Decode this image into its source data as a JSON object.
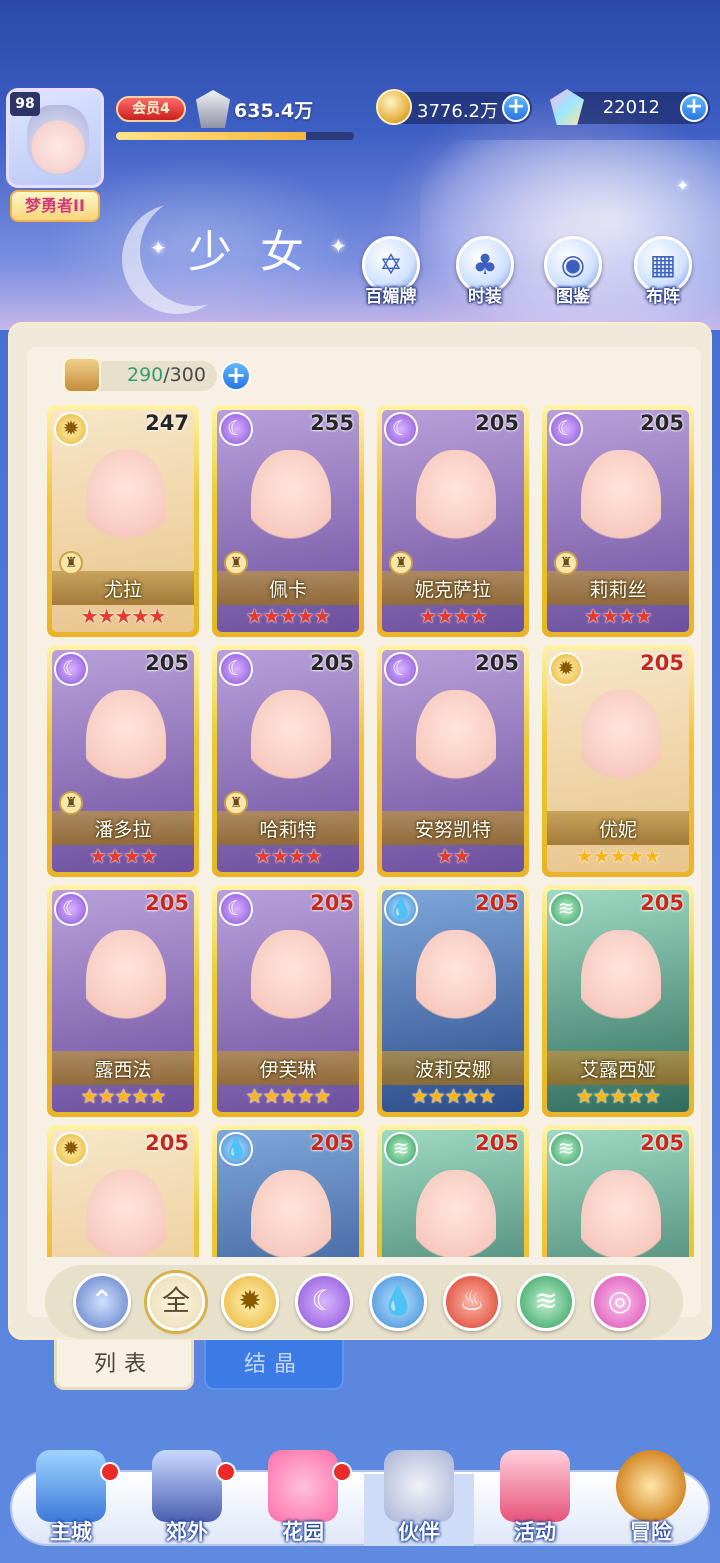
{
  "player": {
    "level": "98",
    "title": "梦勇者II",
    "vip": "会员4",
    "power": "635.4万",
    "power_progress": 0.8,
    "gold": "3776.2万",
    "gems": "22012"
  },
  "header": {
    "title": "少女",
    "buttons": [
      {
        "label": "百媚牌",
        "icon": "card-deck-icon"
      },
      {
        "label": "时装",
        "icon": "outfit-icon"
      },
      {
        "label": "图鉴",
        "icon": "book-icon"
      },
      {
        "label": "布阵",
        "icon": "formation-grid-icon"
      }
    ]
  },
  "capacity": {
    "current": "290",
    "max": "/300"
  },
  "cards": [
    {
      "name": "尤拉",
      "level": "247",
      "element": "light",
      "stars": 5,
      "star_color": "red",
      "chess": true
    },
    {
      "name": "佩卡",
      "level": "255",
      "element": "moon",
      "stars": 5,
      "star_color": "red",
      "chess": true
    },
    {
      "name": "妮克萨拉",
      "level": "205",
      "element": "moon",
      "stars": 4,
      "star_color": "red",
      "chess": true
    },
    {
      "name": "莉莉丝",
      "level": "205",
      "element": "moon",
      "stars": 4,
      "star_color": "red",
      "chess": true
    },
    {
      "name": "潘多拉",
      "level": "205",
      "element": "moon",
      "stars": 4,
      "star_color": "red",
      "chess": true
    },
    {
      "name": "哈莉特",
      "level": "205",
      "element": "moon",
      "stars": 4,
      "star_color": "red",
      "chess": true
    },
    {
      "name": "安努凯特",
      "level": "205",
      "element": "moon",
      "stars": 2,
      "star_color": "red",
      "chess": false
    },
    {
      "name": "优妮",
      "level": "205",
      "element": "light",
      "stars": 5,
      "star_color": "gold",
      "chess": false
    },
    {
      "name": "露西法",
      "level": "205",
      "element": "moon",
      "stars": 5,
      "star_color": "gold",
      "chess": false
    },
    {
      "name": "伊芙琳",
      "level": "205",
      "element": "moon",
      "stars": 5,
      "star_color": "gold",
      "chess": false
    },
    {
      "name": "波莉安娜",
      "level": "205",
      "element": "water",
      "stars": 5,
      "star_color": "gold",
      "chess": false
    },
    {
      "name": "艾露西娅",
      "level": "205",
      "element": "wind",
      "stars": 5,
      "star_color": "gold",
      "chess": false
    },
    {
      "name": "",
      "level": "205",
      "element": "light",
      "stars": 0,
      "star_color": "gold",
      "chess": false
    },
    {
      "name": "",
      "level": "205",
      "element": "water",
      "stars": 0,
      "star_color": "gold",
      "chess": false
    },
    {
      "name": "",
      "level": "205",
      "element": "wind",
      "stars": 0,
      "star_color": "gold",
      "chess": false
    },
    {
      "name": "",
      "level": "205",
      "element": "wind",
      "stars": 0,
      "star_color": "gold",
      "chess": false
    }
  ],
  "filters": [
    {
      "id": "star",
      "label": "",
      "icon": "star-chevron-icon"
    },
    {
      "id": "all",
      "label": "全",
      "icon": "all-icon",
      "selected": true
    },
    {
      "id": "light",
      "label": "",
      "icon": "sun-icon"
    },
    {
      "id": "moon",
      "label": "",
      "icon": "moon-icon"
    },
    {
      "id": "water",
      "label": "",
      "icon": "water-drop-icon"
    },
    {
      "id": "fire",
      "label": "",
      "icon": "fire-icon"
    },
    {
      "id": "wind",
      "label": "",
      "icon": "wind-icon"
    },
    {
      "id": "pink",
      "label": "",
      "icon": "orbit-icon"
    }
  ],
  "tabs": {
    "list": "列表",
    "crystal": "结晶"
  },
  "nav": [
    {
      "label": "主城",
      "icon": "castle-icon",
      "dot": true
    },
    {
      "label": "郊外",
      "icon": "magic-circle-icon",
      "dot": true
    },
    {
      "label": "花园",
      "icon": "heart-icon",
      "dot": true
    },
    {
      "label": "伙伴",
      "icon": "partner-portrait-icon",
      "dot": false,
      "active": true
    },
    {
      "label": "活动",
      "icon": "gift-box-icon",
      "dot": false
    },
    {
      "label": "冒险",
      "icon": "compass-icon",
      "dot": false
    }
  ],
  "colors": {
    "card_gold": "#f0c739",
    "accent_blue": "#2a76e3",
    "star_red": "#e43b30",
    "star_gold": "#ffb417"
  }
}
